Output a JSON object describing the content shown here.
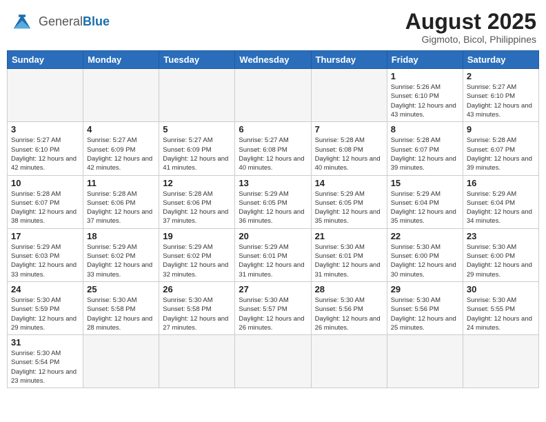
{
  "header": {
    "logo": {
      "general": "General",
      "blue": "Blue"
    },
    "title": "August 2025",
    "subtitle": "Gigmoto, Bicol, Philippines"
  },
  "weekdays": [
    "Sunday",
    "Monday",
    "Tuesday",
    "Wednesday",
    "Thursday",
    "Friday",
    "Saturday"
  ],
  "weeks": [
    [
      {
        "day": "",
        "empty": true
      },
      {
        "day": "",
        "empty": true
      },
      {
        "day": "",
        "empty": true
      },
      {
        "day": "",
        "empty": true
      },
      {
        "day": "",
        "empty": true
      },
      {
        "day": "1",
        "sunrise": "5:26 AM",
        "sunset": "6:10 PM",
        "daylight": "12 hours and 43 minutes."
      },
      {
        "day": "2",
        "sunrise": "5:27 AM",
        "sunset": "6:10 PM",
        "daylight": "12 hours and 43 minutes."
      }
    ],
    [
      {
        "day": "3",
        "sunrise": "5:27 AM",
        "sunset": "6:10 PM",
        "daylight": "12 hours and 42 minutes."
      },
      {
        "day": "4",
        "sunrise": "5:27 AM",
        "sunset": "6:09 PM",
        "daylight": "12 hours and 42 minutes."
      },
      {
        "day": "5",
        "sunrise": "5:27 AM",
        "sunset": "6:09 PM",
        "daylight": "12 hours and 41 minutes."
      },
      {
        "day": "6",
        "sunrise": "5:27 AM",
        "sunset": "6:08 PM",
        "daylight": "12 hours and 40 minutes."
      },
      {
        "day": "7",
        "sunrise": "5:28 AM",
        "sunset": "6:08 PM",
        "daylight": "12 hours and 40 minutes."
      },
      {
        "day": "8",
        "sunrise": "5:28 AM",
        "sunset": "6:07 PM",
        "daylight": "12 hours and 39 minutes."
      },
      {
        "day": "9",
        "sunrise": "5:28 AM",
        "sunset": "6:07 PM",
        "daylight": "12 hours and 39 minutes."
      }
    ],
    [
      {
        "day": "10",
        "sunrise": "5:28 AM",
        "sunset": "6:07 PM",
        "daylight": "12 hours and 38 minutes."
      },
      {
        "day": "11",
        "sunrise": "5:28 AM",
        "sunset": "6:06 PM",
        "daylight": "12 hours and 37 minutes."
      },
      {
        "day": "12",
        "sunrise": "5:28 AM",
        "sunset": "6:06 PM",
        "daylight": "12 hours and 37 minutes."
      },
      {
        "day": "13",
        "sunrise": "5:29 AM",
        "sunset": "6:05 PM",
        "daylight": "12 hours and 36 minutes."
      },
      {
        "day": "14",
        "sunrise": "5:29 AM",
        "sunset": "6:05 PM",
        "daylight": "12 hours and 35 minutes."
      },
      {
        "day": "15",
        "sunrise": "5:29 AM",
        "sunset": "6:04 PM",
        "daylight": "12 hours and 35 minutes."
      },
      {
        "day": "16",
        "sunrise": "5:29 AM",
        "sunset": "6:04 PM",
        "daylight": "12 hours and 34 minutes."
      }
    ],
    [
      {
        "day": "17",
        "sunrise": "5:29 AM",
        "sunset": "6:03 PM",
        "daylight": "12 hours and 33 minutes."
      },
      {
        "day": "18",
        "sunrise": "5:29 AM",
        "sunset": "6:02 PM",
        "daylight": "12 hours and 33 minutes."
      },
      {
        "day": "19",
        "sunrise": "5:29 AM",
        "sunset": "6:02 PM",
        "daylight": "12 hours and 32 minutes."
      },
      {
        "day": "20",
        "sunrise": "5:29 AM",
        "sunset": "6:01 PM",
        "daylight": "12 hours and 31 minutes."
      },
      {
        "day": "21",
        "sunrise": "5:30 AM",
        "sunset": "6:01 PM",
        "daylight": "12 hours and 31 minutes."
      },
      {
        "day": "22",
        "sunrise": "5:30 AM",
        "sunset": "6:00 PM",
        "daylight": "12 hours and 30 minutes."
      },
      {
        "day": "23",
        "sunrise": "5:30 AM",
        "sunset": "6:00 PM",
        "daylight": "12 hours and 29 minutes."
      }
    ],
    [
      {
        "day": "24",
        "sunrise": "5:30 AM",
        "sunset": "5:59 PM",
        "daylight": "12 hours and 29 minutes."
      },
      {
        "day": "25",
        "sunrise": "5:30 AM",
        "sunset": "5:58 PM",
        "daylight": "12 hours and 28 minutes."
      },
      {
        "day": "26",
        "sunrise": "5:30 AM",
        "sunset": "5:58 PM",
        "daylight": "12 hours and 27 minutes."
      },
      {
        "day": "27",
        "sunrise": "5:30 AM",
        "sunset": "5:57 PM",
        "daylight": "12 hours and 26 minutes."
      },
      {
        "day": "28",
        "sunrise": "5:30 AM",
        "sunset": "5:56 PM",
        "daylight": "12 hours and 26 minutes."
      },
      {
        "day": "29",
        "sunrise": "5:30 AM",
        "sunset": "5:56 PM",
        "daylight": "12 hours and 25 minutes."
      },
      {
        "day": "30",
        "sunrise": "5:30 AM",
        "sunset": "5:55 PM",
        "daylight": "12 hours and 24 minutes."
      }
    ],
    [
      {
        "day": "31",
        "sunrise": "5:30 AM",
        "sunset": "5:54 PM",
        "daylight": "12 hours and 23 minutes."
      },
      {
        "day": "",
        "empty": true
      },
      {
        "day": "",
        "empty": true
      },
      {
        "day": "",
        "empty": true
      },
      {
        "day": "",
        "empty": true
      },
      {
        "day": "",
        "empty": true
      },
      {
        "day": "",
        "empty": true
      }
    ]
  ]
}
